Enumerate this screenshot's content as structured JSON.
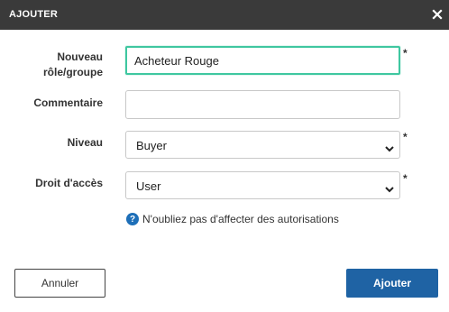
{
  "dialog": {
    "title": "AJOUTER",
    "close_icon": "close-icon"
  },
  "form": {
    "role": {
      "label": "Nouveau rôle/groupe",
      "value": "Acheteur Rouge",
      "required_mark": "*"
    },
    "comment": {
      "label": "Commentaire",
      "value": ""
    },
    "level": {
      "label": "Niveau",
      "selected": "Buyer",
      "required_mark": "*"
    },
    "access": {
      "label": "Droit d'accès",
      "selected": "User",
      "required_mark": "*"
    }
  },
  "hint": {
    "icon": "question-icon",
    "text": "N'oubliez pas d'affecter des autorisations"
  },
  "buttons": {
    "cancel": "Annuler",
    "add": "Ajouter"
  },
  "colors": {
    "titlebar": "#3a3a3a",
    "focus_border": "#3fc7a0",
    "primary": "#1f63a4",
    "hint_icon": "#1e6fb8"
  }
}
